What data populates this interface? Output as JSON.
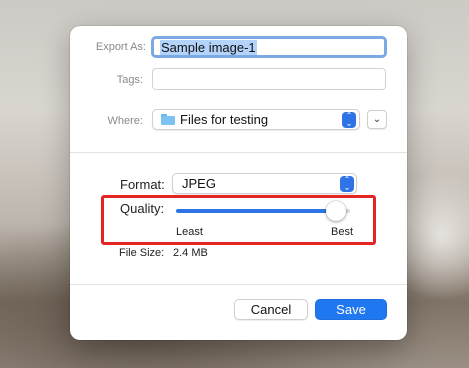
{
  "dialog": {
    "export_as_label": "Export As:",
    "export_as_value": "Sample image-1",
    "tags_label": "Tags:",
    "tags_value": "",
    "where_label": "Where:",
    "where_value": "Files for testing",
    "format_label": "Format:",
    "format_value": "JPEG",
    "quality_label": "Quality:",
    "quality_level": 0.92,
    "quality_min_label": "Least",
    "quality_max_label": "Best",
    "file_size_label": "File Size:",
    "file_size_value": "2.4 MB",
    "cancel_label": "Cancel",
    "save_label": "Save"
  },
  "icons": {
    "folder": "folder-icon",
    "stepper": "up-down-chevron-icon",
    "expand": "chevron-down-icon"
  },
  "colors": {
    "accent": "#2f74e6",
    "highlight": "#e52424",
    "save_button": "#1f78f0"
  }
}
